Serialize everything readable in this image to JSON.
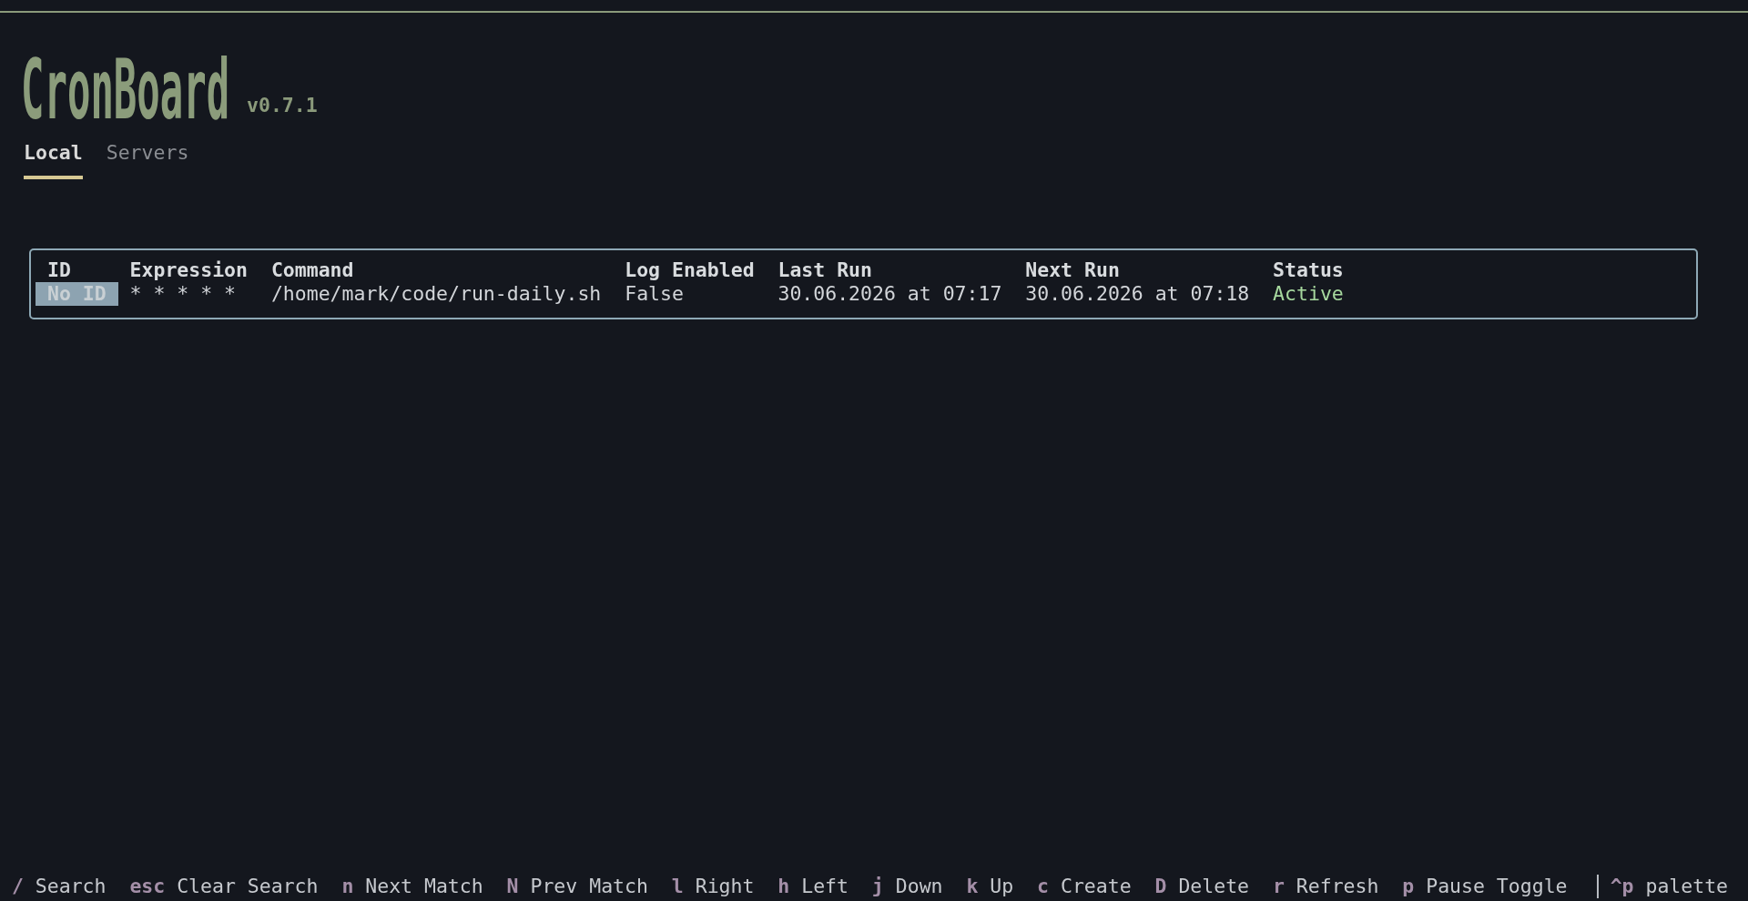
{
  "header": {
    "logo": "CronBoard",
    "version": "v0.7.1"
  },
  "tabs": [
    {
      "label": "Local",
      "selected": true
    },
    {
      "label": "Servers",
      "selected": false
    }
  ],
  "table": {
    "columns": [
      "ID",
      "Expression",
      "Command",
      "Log Enabled",
      "Last Run",
      "Next Run",
      "Status"
    ],
    "rows": [
      {
        "cells": [
          {
            "text": "No ID",
            "selected": true
          },
          {
            "text": "* * * * *",
            "selected": false
          },
          {
            "text": "/home/mark/code/run-daily.sh",
            "selected": false
          },
          {
            "text": "False",
            "selected": false
          },
          {
            "text": "30.06.2026 at 07:17",
            "selected": false
          },
          {
            "text": "30.06.2026 at 07:18",
            "selected": false
          },
          {
            "text": "Active",
            "selected": false,
            "color": "#a6d89e"
          }
        ]
      }
    ]
  },
  "footer": {
    "bindings": [
      {
        "key": "/",
        "label": "Search"
      },
      {
        "key": "esc",
        "label": "Clear Search"
      },
      {
        "key": "n",
        "label": "Next Match"
      },
      {
        "key": "N",
        "label": "Prev Match"
      },
      {
        "key": "l",
        "label": "Right"
      },
      {
        "key": "h",
        "label": "Left"
      },
      {
        "key": "j",
        "label": "Down"
      },
      {
        "key": "k",
        "label": "Up"
      },
      {
        "key": "c",
        "label": "Create"
      },
      {
        "key": "D",
        "label": "Delete"
      },
      {
        "key": "r",
        "label": "Refresh"
      },
      {
        "key": "p",
        "label": "Pause Toggle"
      }
    ],
    "palette": {
      "key": "^p",
      "label": "palette"
    }
  }
}
